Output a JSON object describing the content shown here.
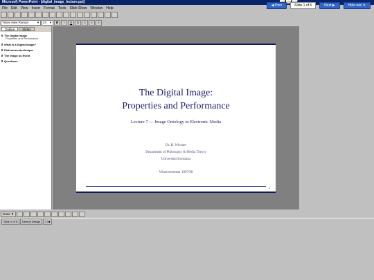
{
  "window": {
    "title": "Microsoft PowerPoint - [digital_image_lecture.ppt]"
  },
  "external_nav": {
    "prev_label": "◀ Prev",
    "counter": "Slide 1 of 5",
    "next_label": "Next ▶",
    "hide_label": "Hide nav ✕"
  },
  "menu": [
    "File",
    "Edit",
    "View",
    "Insert",
    "Format",
    "Tools",
    "Slide Show",
    "Window",
    "Help"
  ],
  "formatting": {
    "font": "Times New Roman",
    "size": "24",
    "bold": "B",
    "italic": "I",
    "underline": "U",
    "shadow": "S"
  },
  "outline_pane": {
    "tabs": [
      "Outline",
      "Slides"
    ],
    "items": [
      {
        "title": "The Digital Image",
        "subtitle": "Properties and Performance"
      },
      {
        "title": "What is a Digital Image?",
        "subtitle": ""
      },
      {
        "title": "Phänomenotechnique",
        "subtitle": ""
      },
      {
        "title": "The Image as Event",
        "subtitle": ""
      },
      {
        "title": "Questions",
        "subtitle": ""
      }
    ]
  },
  "slide": {
    "title_line1": "The Digital Image:",
    "title_line2": "Properties and Performance",
    "subtitle": "Lecture 7 — Image Ontology in Electronic Media",
    "author": "Dr. H. Wiesner",
    "department": "Department of Philosophy & Media Theory",
    "university": "Universität Konstanz",
    "semester": "Wintersemester 1997/98",
    "number": "1"
  },
  "drawbar": {
    "draw_label": "Draw ▼"
  },
  "statusbar": {
    "slide_info": "Slide 1 of 5",
    "design": "Default Design",
    "spell_icon": "☐ ■"
  }
}
